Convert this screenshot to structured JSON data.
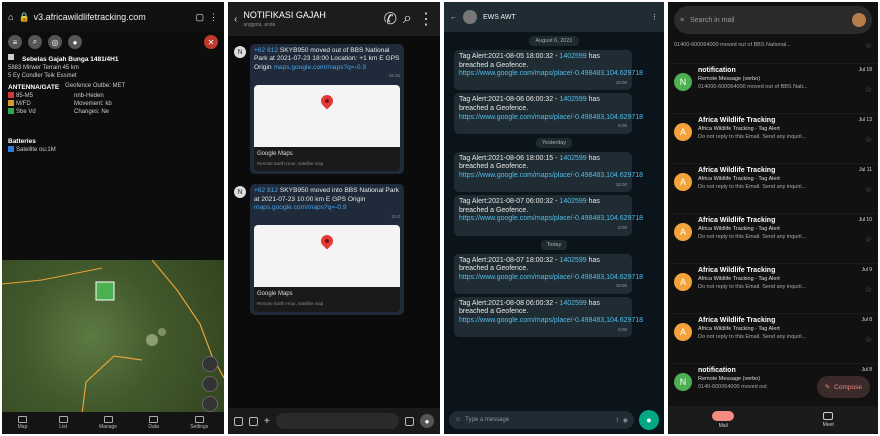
{
  "browser": {
    "url": "v3.africawildlifetracking.com",
    "info": {
      "collar_name": "Sebelas Gajah Bunga 1481/4H1",
      "collar_line1": "5883 Mirwer Terrain 45 km",
      "collar_line2": "5 Ey Condler Teik Essmet",
      "section_title": "ANTENNA/GATE",
      "section_status": "Geofence Outbe: MET",
      "rows": [
        {
          "label": "85-M5",
          "value": "nnb-Heden",
          "color": "#d13a3a"
        },
        {
          "label": "M/FD",
          "value": "Movement: kb",
          "color": "#d89b2a"
        },
        {
          "label": "Sbe Vd",
          "value": "Changes: Ne",
          "color": "#2fa84f"
        }
      ],
      "extra_title": "Batteries",
      "extra_value": "Satellite ou:1M"
    },
    "bottom_nav": [
      "Map",
      "List",
      "Manage",
      "Data",
      "Settings"
    ]
  },
  "chat": {
    "title": "NOTIFIKASI GAJAH",
    "subtitle": "anggota, anda",
    "messages": [
      {
        "avatar": "N",
        "prefix": "+62 812",
        "text": "SKYB950 moved out of BBS National Park at 2021-07-23 18:00",
        "suffix": "Location: +1 km E GPS Origin",
        "link": "maps.google.com/maps?q=-0.9",
        "time": "19.45",
        "card_title": "Google Maps",
        "card_sub": "Remote Earth Hour, satellite map"
      },
      {
        "avatar": "N",
        "prefix": "+62 812",
        "text": "SKYB950 moved into BBS National Park at 2021-07-23 10:00",
        "suffix": "km E GPS Origin",
        "link": "maps.google.com/maps?q=-0.9",
        "time": "10.0",
        "card_title": "Google Maps",
        "card_sub": "Remote Earth Hour, satellite map"
      }
    ]
  },
  "whatsapp": {
    "title": "EWS AWT",
    "input_placeholder": "Type a message",
    "dates": [
      "August 6, 2021",
      "Yesterday",
      "Today"
    ],
    "messages": [
      {
        "head": "Tag Alert:2021-08-05 18:00:32 -",
        "id": "1402599",
        "tail": "has breached a Geofence.",
        "link": "https://www.google.com/maps/place/-0.498483,104.629718",
        "time": "18:00"
      },
      {
        "head": "Tag Alert:2021-08-06 06:00:32 -",
        "id": "1402599",
        "tail": "has breached a Geofence.",
        "link": "https://www.google.com/maps/place/-0.498483,104.629718",
        "time": "6:00"
      },
      {
        "head": "Tag Alert:2021-08-06 18:00:15 -",
        "id": "1402599",
        "tail": "has breached a Geofence.",
        "link": "https://www.google.com/maps/place/-0.498483,104.629718",
        "time": "18:00"
      },
      {
        "head": "Tag Alert:2021-08-07 06:00:32 -",
        "id": "1402599",
        "tail": "has breached a Geofence.",
        "link": "https://www.google.com/maps/place/-0.498483,104.629718",
        "time": "6:00"
      },
      {
        "head": "Tag Alert:2021-08-07 18:00:32 -",
        "id": "1402599",
        "tail": "has breached a Geofence.",
        "link": "https://www.google.com/maps/place/-0.498483,104.629718",
        "time": "18:00"
      },
      {
        "head": "Tag Alert:2021-08-08 06:00:32 -",
        "id": "1402599",
        "tail": "has breached a Geofence.",
        "link": "https://www.google.com/maps/place/-0.498483,104.629718",
        "time": "6:00"
      }
    ]
  },
  "gmail": {
    "search_placeholder": "Search in mail",
    "compose_label": "Compose",
    "tabs": [
      "Mail",
      "Meet"
    ],
    "mails": [
      {
        "avatar": "",
        "color": "",
        "sender": "",
        "subject": "",
        "snippet": "01400-600064000 moved out of BBS National...",
        "date": ""
      },
      {
        "avatar": "N",
        "color": "#4caf50",
        "sender": "notification",
        "subject": "Remote Message (verbo)",
        "snippet": "014000-600064000 moved out of BBS Nati...",
        "date": "Jul 18"
      },
      {
        "avatar": "A",
        "color": "#f2a33a",
        "sender": "Africa Wildlife Tracking",
        "subject": "Africa Wildlife Tracking - Tag Alert",
        "snippet": "Do not reply to this Email. Send any inquiri...",
        "date": "Jul 13"
      },
      {
        "avatar": "A",
        "color": "#f2a33a",
        "sender": "Africa Wildlife Tracking",
        "subject": "Africa Wildlife Tracking - Tag Alert",
        "snippet": "Do not reply to this Email. Send any inquiri...",
        "date": "Jul 11"
      },
      {
        "avatar": "A",
        "color": "#f2a33a",
        "sender": "Africa Wildlife Tracking",
        "subject": "Africa Wildlife Tracking - Tag Alert",
        "snippet": "Do not reply to this Email. Send any inquiri...",
        "date": "Jul 10"
      },
      {
        "avatar": "A",
        "color": "#f2a33a",
        "sender": "Africa Wildlife Tracking",
        "subject": "Africa Wildlife Tracking - Tag Alert",
        "snippet": "Do not reply to this Email. Send any inquiri...",
        "date": "Jul 9"
      },
      {
        "avatar": "A",
        "color": "#f2a33a",
        "sender": "Africa Wildlife Tracking",
        "subject": "Africa Wildlife Tracking - Tag Alert",
        "snippet": "Do not reply to this Email. Send any inquiri...",
        "date": "Jul 8"
      },
      {
        "avatar": "N",
        "color": "#4caf50",
        "sender": "notification",
        "subject": "Remote Message (verbo)",
        "snippet": "0140-600064000 moved out",
        "date": "Jul 8"
      }
    ]
  }
}
